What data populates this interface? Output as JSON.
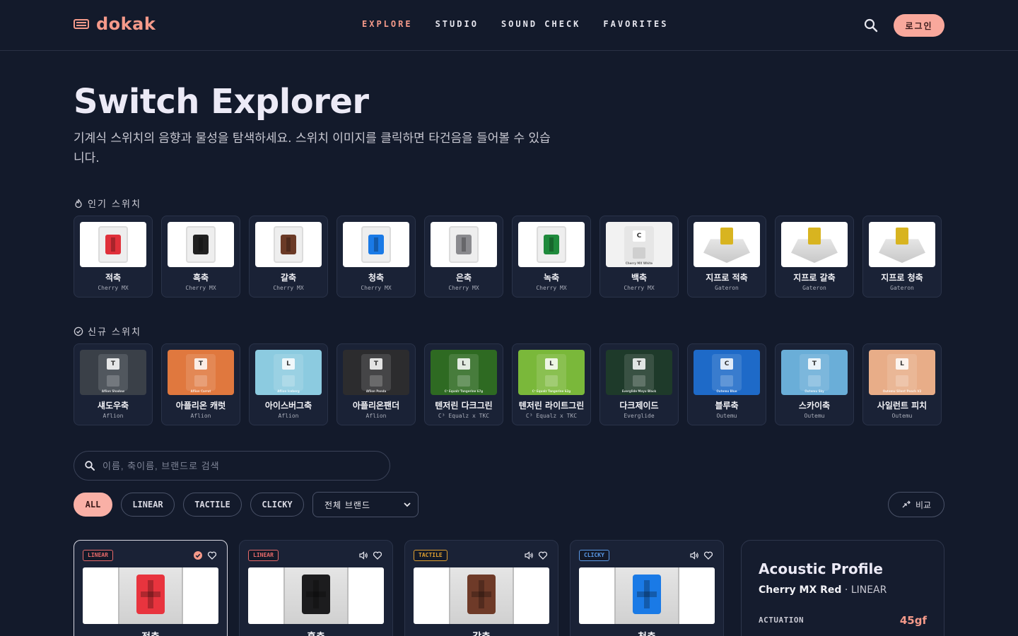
{
  "header": {
    "logo": "dokak",
    "nav": [
      "EXPLORE",
      "STUDIO",
      "SOUND CHECK",
      "FAVORITES"
    ],
    "login": "로그인"
  },
  "hero": {
    "title": "Switch Explorer",
    "description": "기계식 스위치의 음향과 물성을 탐색하세요. 스위치 이미지를 클릭하면 타건음을 들어볼 수 있습니다."
  },
  "popular": {
    "heading": "인기 스위치",
    "items": [
      {
        "name": "적축",
        "brand": "Cherry MX",
        "color": "#e0303a",
        "style": "cherry"
      },
      {
        "name": "흑축",
        "brand": "Cherry MX",
        "color": "#202020",
        "style": "cherry"
      },
      {
        "name": "갈축",
        "brand": "Cherry MX",
        "color": "#6b3a26",
        "style": "cherry"
      },
      {
        "name": "청축",
        "brand": "Cherry MX",
        "color": "#1a7ae6",
        "style": "cherry"
      },
      {
        "name": "은축",
        "brand": "Cherry MX",
        "color": "#8a8a8e",
        "style": "cherry"
      },
      {
        "name": "녹축",
        "brand": "Cherry MX",
        "color": "#1f8a3c",
        "style": "cherry"
      },
      {
        "name": "백축",
        "brand": "Cherry MX",
        "color": "#eeeeee",
        "style": "white",
        "badge": "C",
        "label": "Cherry MX White"
      },
      {
        "name": "지프로 적축",
        "brand": "Gateron",
        "color": "#d8b420",
        "style": "gold"
      },
      {
        "name": "지프로 갈축",
        "brand": "Gateron",
        "color": "#d8b420",
        "style": "gold"
      },
      {
        "name": "지프로 청축",
        "brand": "Gateron",
        "color": "#d8b420",
        "style": "gold"
      }
    ]
  },
  "new": {
    "heading": "신규 스위치",
    "items": [
      {
        "name": "섀도우축",
        "brand": "Aflion",
        "badge": "T",
        "bg": "#3a4048",
        "label": "Aflion Shadow"
      },
      {
        "name": "아플리온 캐럿",
        "brand": "Aflion",
        "badge": "T",
        "bg": "#e0783e",
        "label": "Aflion Carrot"
      },
      {
        "name": "아이스버그축",
        "brand": "Aflion",
        "badge": "L",
        "bg": "#8ccbe0",
        "label": "Aflion Iceberg"
      },
      {
        "name": "아플리온팬더",
        "brand": "Aflion",
        "badge": "T",
        "bg": "#2c2c2e",
        "label": "Aflion Panda"
      },
      {
        "name": "텐저린 다크그린",
        "brand": "C³ Equalz x TKC",
        "badge": "L",
        "bg": "#2e6a22",
        "label": "C³ Equalz Tangerine 67g"
      },
      {
        "name": "텐저린 라이트그린",
        "brand": "C³ Equalz x TKC",
        "badge": "L",
        "bg": "#7ab83a",
        "label": "C³ Equalz Tangerine 62g"
      },
      {
        "name": "다크제이드",
        "brand": "Everglide",
        "badge": "T",
        "bg": "#1e3a2a",
        "label": "Everglide Moyu Black"
      },
      {
        "name": "블루축",
        "brand": "Outemu",
        "badge": "C",
        "bg": "#1e6ac8",
        "label": "Outemu Blue"
      },
      {
        "name": "스카이축",
        "brand": "Outemu",
        "badge": "T",
        "bg": "#6aaed8",
        "label": "Outemu Sky"
      },
      {
        "name": "사일런트 피치",
        "brand": "Outemu",
        "badge": "L",
        "bg": "#e8ad88",
        "label": "Outemu Silent Peach V2"
      }
    ]
  },
  "search": {
    "placeholder": "이름, 축이름, 브랜드로 검색"
  },
  "filters": {
    "chips": [
      "ALL",
      "LINEAR",
      "TACTILE",
      "CLICKY"
    ],
    "brand": "전체 브랜드",
    "compare": "비교"
  },
  "products": [
    {
      "tag": "LINEAR",
      "name": "적축",
      "color": "#e8343e",
      "tagColor": "#e86a6a"
    },
    {
      "tag": "LINEAR",
      "name": "흑축",
      "color": "#1c1c1e",
      "tagColor": "#e86a6a"
    },
    {
      "tag": "TACTILE",
      "name": "갈축",
      "color": "#6e3a28",
      "tagColor": "#e0a030"
    },
    {
      "tag": "CLICKY",
      "name": "청축",
      "color": "#1a7ae6",
      "tagColor": "#5a9ae8"
    }
  ],
  "profile": {
    "title": "Acoustic Profile",
    "switch": "Cherry MX Red",
    "type": "LINEAR",
    "actuation_label": "ACTUATION",
    "actuation_value": "45gf"
  },
  "colors": {
    "accent": "#f59a8a",
    "background": "#131a2b",
    "card": "#1a2236"
  }
}
